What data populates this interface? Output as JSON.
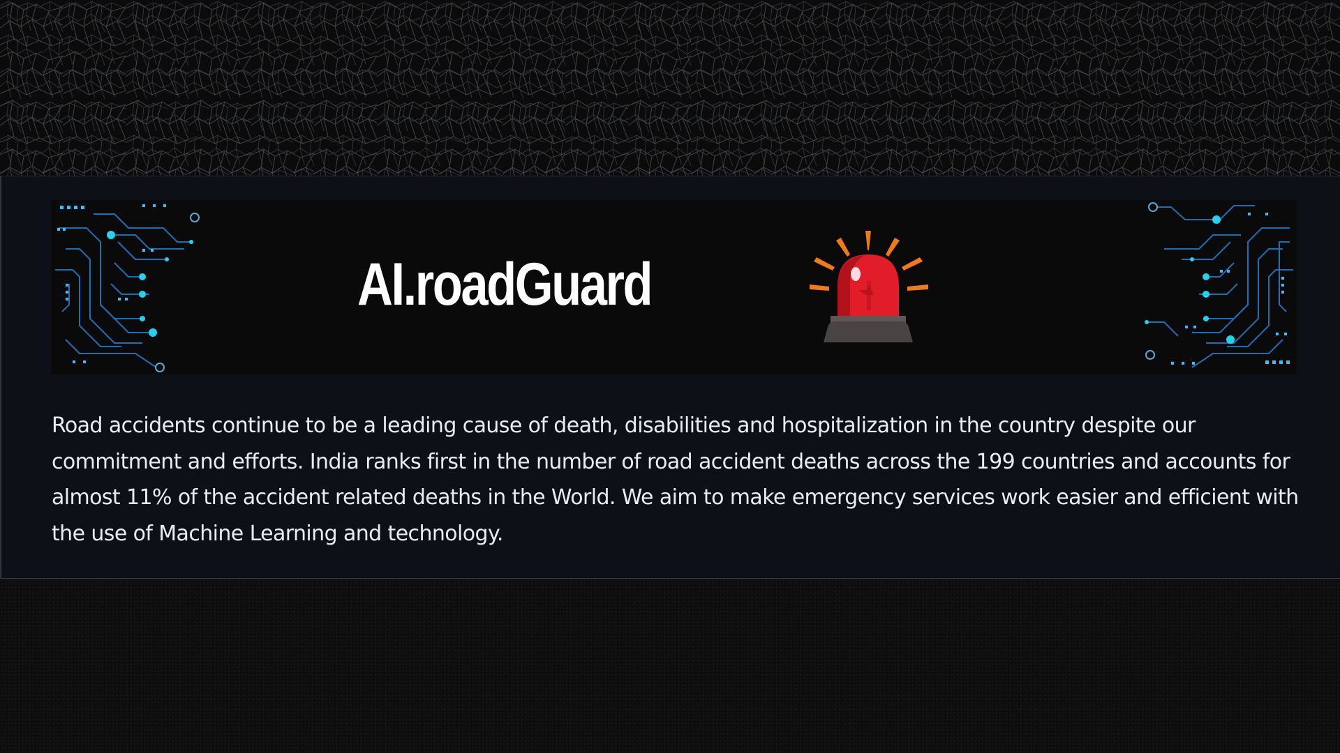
{
  "banner": {
    "title": "AI.roadGuard"
  },
  "description": "Road accidents continue to be a leading cause of death, disabilities and hospitalization in the country despite our commitment and efforts. India ranks first in the number of road accident deaths across the 199 countries and accounts for almost 11% of the accident related deaths in the World. We aim to make emergency services work easier and efficient with the use of Machine Learning and technology.",
  "icons": {
    "siren": "siren-alarm-icon",
    "circuit_left": "circuit-board-left-icon",
    "circuit_right": "circuit-board-right-icon"
  },
  "colors": {
    "card_bg": "#0d1117",
    "banner_bg": "#0a0a0b",
    "text": "#e6edf3",
    "circuit_accent": "#22d3ee",
    "circuit_line": "#1f6fb5",
    "siren_red": "#e11d2a",
    "siren_rays": "#f07a1a"
  }
}
